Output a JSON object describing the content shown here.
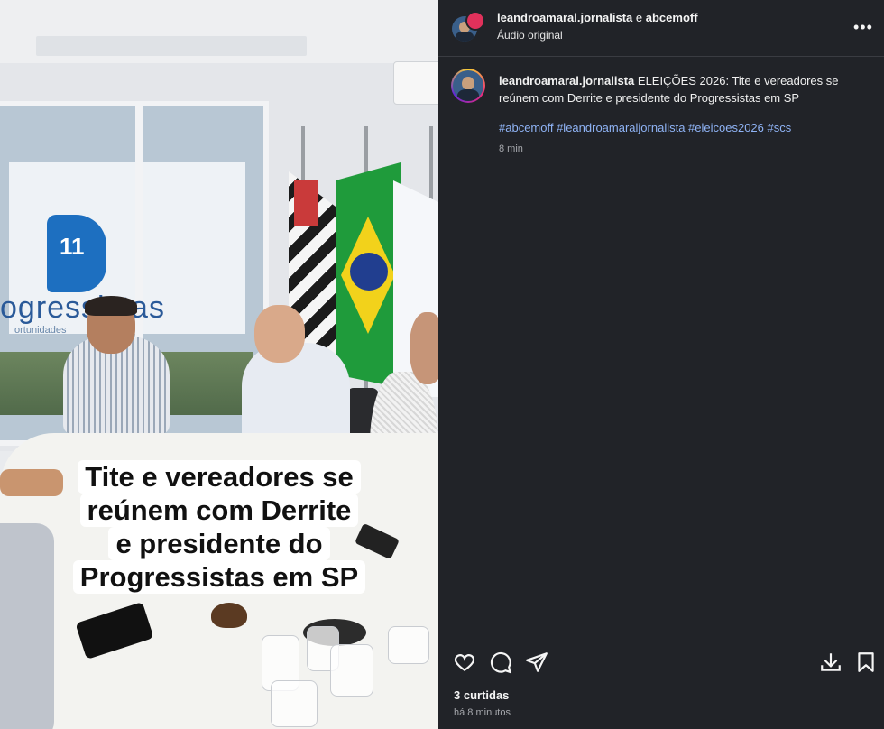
{
  "media": {
    "caption_lines": [
      "Tite e vereadores se",
      "reúnem com Derrite",
      "e presidente do",
      "Progressistas em SP"
    ],
    "logo_number": "11",
    "logo_word": "ogressistas",
    "logo_subtext": "ortunidades"
  },
  "header": {
    "author": "leandroamaral.jornalista",
    "connector": "e",
    "coauthor": "abcemoff",
    "audio": "Áudio original",
    "more_icon": "more-horizontal-icon"
  },
  "post": {
    "author": "leandroamaral.jornalista",
    "text": "ELEIÇÕES 2026: Tite e vereadores se reúnem com Derrite e presidente do Progressistas em SP",
    "hashtags": "#abcemoff #leandroamaraljornalista #eleicoes2026 #scs",
    "age": "8 min"
  },
  "actions": {
    "like_icon": "heart-icon",
    "comment_icon": "comment-icon",
    "share_icon": "share-icon",
    "download_icon": "download-icon",
    "save_icon": "bookmark-icon"
  },
  "footer": {
    "likes": "3 curtidas",
    "timestamp": "há 8 minutos"
  },
  "colors": {
    "panel_bg": "#212328",
    "hashtag": "#8fb3f5",
    "muted": "#a6a8ad"
  }
}
